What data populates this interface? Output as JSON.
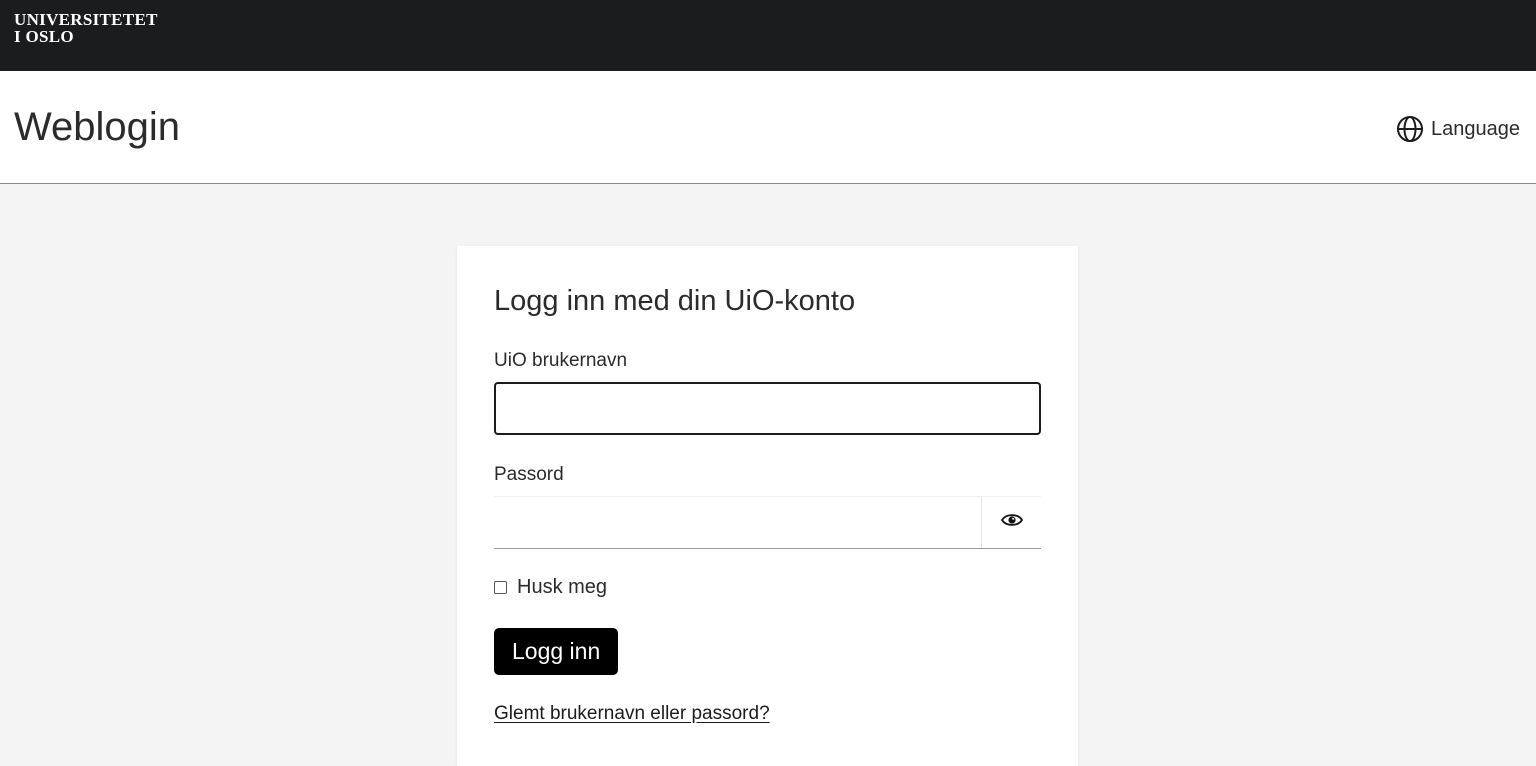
{
  "topbar": {
    "logo_line1": "UNIVERSITETET",
    "logo_line2": "I OSLO"
  },
  "header": {
    "title": "Weblogin",
    "language_label": "Language",
    "language_icon": "globe-icon"
  },
  "login": {
    "heading": "Logg inn med din UiO-konto",
    "username_label": "UiO brukernavn",
    "username_value": "",
    "password_label": "Passord",
    "password_value": "",
    "show_password_icon": "eye-icon",
    "remember_label": "Husk meg",
    "remember_checked": false,
    "submit_label": "Logg inn",
    "forgot_label": "Glemt brukernavn eller passord?"
  },
  "colors": {
    "topbar_bg": "#1b1c1e",
    "page_bg": "#f4f4f4",
    "button_bg": "#000000"
  }
}
